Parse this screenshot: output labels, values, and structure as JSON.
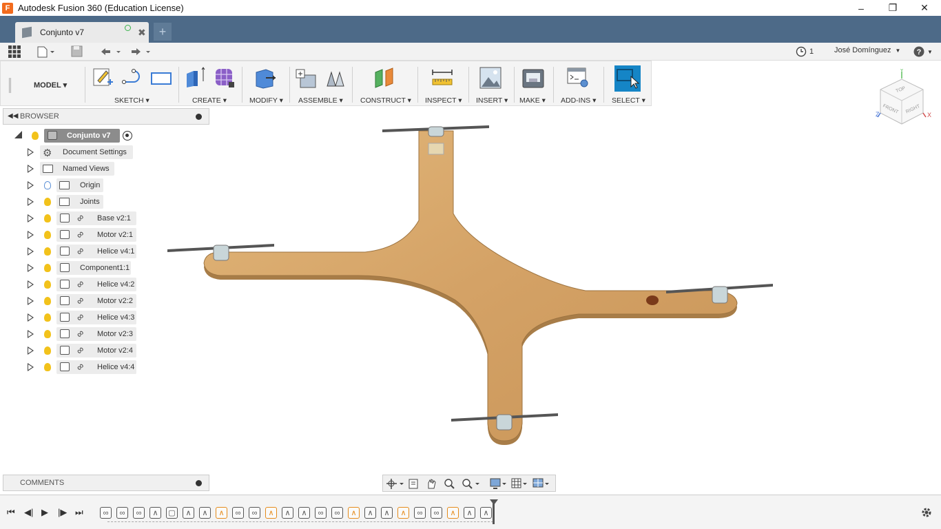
{
  "window": {
    "title": "Autodesk Fusion 360 (Education License)"
  },
  "tab": {
    "name": "Conjunto v7"
  },
  "qat": {
    "jobs_count": "1",
    "user": "José Domínguez"
  },
  "toolbar": {
    "workspace": "MODEL",
    "groups": [
      "SKETCH",
      "CREATE",
      "MODIFY",
      "ASSEMBLE",
      "CONSTRUCT",
      "INSPECT",
      "INSERT",
      "MAKE",
      "ADD-INS",
      "SELECT"
    ]
  },
  "viewcube": {
    "top": "TOP",
    "front": "FRONT",
    "right": "RIGHT",
    "x": "X",
    "y": "Y",
    "z": "Z"
  },
  "browser": {
    "title": "BROWSER",
    "root": "Conjunto v7",
    "items": [
      {
        "label": "Document Settings",
        "kind": "settings"
      },
      {
        "label": "Named Views",
        "kind": "folder"
      },
      {
        "label": "Origin",
        "kind": "folder",
        "bulb": "blue"
      },
      {
        "label": "Joints",
        "kind": "folder",
        "bulb": "yellow"
      },
      {
        "label": "Base v2:1",
        "kind": "link",
        "bulb": "yellow"
      },
      {
        "label": "Motor v2:1",
        "kind": "link",
        "bulb": "yellow"
      },
      {
        "label": "Helice v4:1",
        "kind": "link",
        "bulb": "yellow"
      },
      {
        "label": "Component1:1",
        "kind": "component",
        "bulb": "yellow"
      },
      {
        "label": "Helice v4:2",
        "kind": "link",
        "bulb": "yellow"
      },
      {
        "label": "Motor v2:2",
        "kind": "link",
        "bulb": "yellow"
      },
      {
        "label": "Helice v4:3",
        "kind": "link",
        "bulb": "yellow"
      },
      {
        "label": "Motor v2:3",
        "kind": "link",
        "bulb": "yellow"
      },
      {
        "label": "Motor v2:4",
        "kind": "link",
        "bulb": "yellow"
      },
      {
        "label": "Helice v4:4",
        "kind": "link",
        "bulb": "yellow"
      }
    ]
  },
  "comments": {
    "title": "COMMENTS"
  },
  "colors": {
    "tabbar": "#4d6a88",
    "accent": "#1585c6",
    "wood": "#d9a865",
    "bulb": "#f2c21b"
  },
  "timeline": {
    "features": [
      "link",
      "link",
      "link",
      "joint",
      "box",
      "joint",
      "joint",
      "orange",
      "link",
      "link",
      "orange",
      "joint",
      "joint",
      "link",
      "link",
      "orange",
      "joint",
      "joint",
      "orange",
      "link",
      "link",
      "orange",
      "joint",
      "joint"
    ]
  }
}
